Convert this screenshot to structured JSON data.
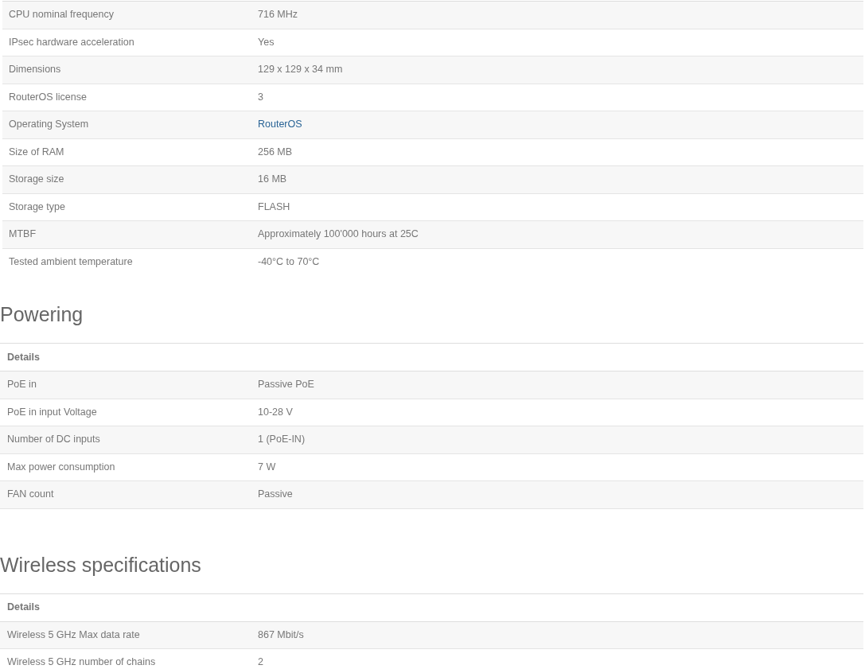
{
  "sections": [
    {
      "rows": [
        {
          "label": "CPU nominal frequency",
          "value": "716 MHz",
          "kind": "text"
        },
        {
          "label": "IPsec hardware acceleration",
          "value": "Yes",
          "kind": "text"
        },
        {
          "label": "Dimensions",
          "value": "129 x 129 x 34 mm",
          "kind": "text"
        },
        {
          "label": "RouterOS license",
          "value": "3",
          "kind": "text"
        },
        {
          "label": "Operating System",
          "value": "RouterOS",
          "kind": "link"
        },
        {
          "label": "Size of RAM",
          "value": "256 MB",
          "kind": "text"
        },
        {
          "label": "Storage size",
          "value": "16 MB",
          "kind": "text"
        },
        {
          "label": "Storage type",
          "value": "FLASH",
          "kind": "text"
        },
        {
          "label": "MTBF",
          "value": "Approximately 100'000 hours at 25C",
          "kind": "text"
        },
        {
          "label": "Tested ambient temperature",
          "value": "-40°C to 70°C",
          "kind": "text"
        }
      ]
    },
    {
      "heading": "Powering",
      "header": "Details",
      "rows": [
        {
          "label": "PoE in",
          "value": "Passive PoE",
          "kind": "text"
        },
        {
          "label": "PoE in input Voltage",
          "value": "10-28 V",
          "kind": "text"
        },
        {
          "label": "Number of DC inputs",
          "value": "1 (PoE-IN)",
          "kind": "text"
        },
        {
          "label": "Max power consumption",
          "value": "7 W",
          "kind": "text"
        },
        {
          "label": "FAN count",
          "value": "Passive",
          "kind": "text"
        }
      ]
    },
    {
      "heading": "Wireless specifications",
      "header": "Details",
      "rows": [
        {
          "label": "Wireless 5 GHz Max data rate",
          "value": "867 Mbit/s",
          "kind": "text"
        },
        {
          "label": "Wireless 5 GHz number of chains",
          "value": "2",
          "kind": "text"
        }
      ]
    }
  ]
}
